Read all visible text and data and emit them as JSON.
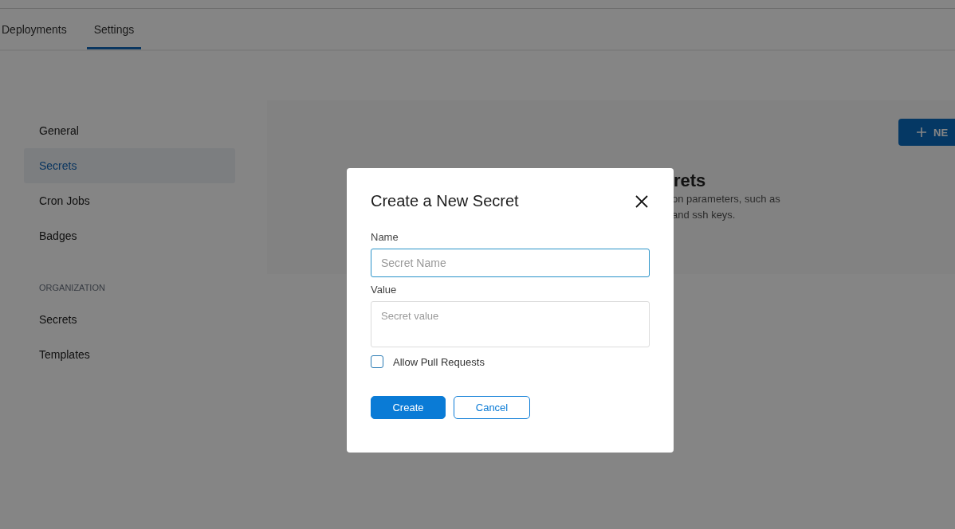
{
  "tabs": [
    {
      "label": "Deployments",
      "selected": false
    },
    {
      "label": "Settings",
      "selected": true
    }
  ],
  "sidebar": {
    "sections": [
      {
        "items": [
          {
            "label": "General",
            "selected": false
          },
          {
            "label": "Secrets",
            "selected": true
          },
          {
            "label": "Cron Jobs",
            "selected": false
          },
          {
            "label": "Badges",
            "selected": false
          }
        ]
      },
      {
        "heading": "ORGANIZATION",
        "items": [
          {
            "label": "Secrets",
            "selected": false
          },
          {
            "label": "Templates",
            "selected": false
          }
        ]
      }
    ]
  },
  "content": {
    "title": "rets",
    "description_lines": [
      "on parameters, such as",
      "and ssh keys."
    ],
    "new_button": "NE"
  },
  "dialog": {
    "title": "Create a New Secret",
    "fields": [
      {
        "kind": "input",
        "label": "Name",
        "placeholder": "Secret Name",
        "focused": true
      },
      {
        "kind": "textarea",
        "label": "Value",
        "placeholder": "Secret value",
        "focused": false
      }
    ],
    "checkbox": {
      "label": "Allow Pull Requests",
      "checked": false
    },
    "buttons": [
      {
        "kind": "primary",
        "label": "Create"
      },
      {
        "kind": "secondary",
        "label": "Cancel"
      }
    ]
  }
}
